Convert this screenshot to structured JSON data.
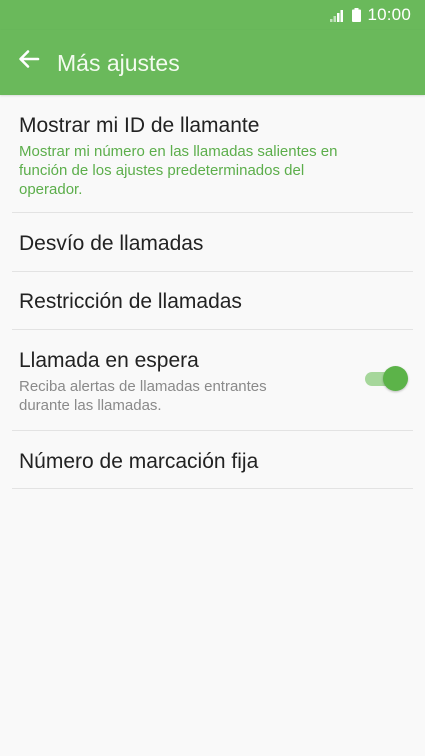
{
  "status_bar": {
    "time": "10:00",
    "icons": [
      "signal-icon",
      "battery-icon"
    ]
  },
  "app_bar": {
    "back_icon": "arrow-left-icon",
    "title": "Más ajustes"
  },
  "colors": {
    "accent": "#6ab95b",
    "subtitle_green": "#5cae4b",
    "toggle_on": "#5cb349"
  },
  "settings": {
    "items": [
      {
        "title": "Mostrar mi ID de llamante",
        "subtitle": "Mostrar mi número en las llamadas salientes en función de los ajustes predeterminados del operador."
      },
      {
        "title": "Desvío de llamadas"
      },
      {
        "title": "Restricción de llamadas"
      },
      {
        "title": "Llamada en espera",
        "subtitle": "Reciba alertas de llamadas entrantes durante las llamadas.",
        "toggle_on": true
      },
      {
        "title": "Número de marcación fija"
      }
    ]
  }
}
